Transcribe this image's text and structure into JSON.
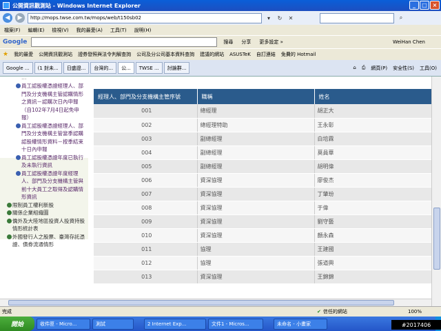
{
  "window": {
    "title": "公開資訊觀測站 - Windows Internet Explorer",
    "buttons": {
      "minimize": "_",
      "maximize": "□",
      "close": "×"
    }
  },
  "address_bar": {
    "url": "http://mops.twse.com.tw/mops/web/t150sb02",
    "back": "◀",
    "forward": "▶"
  },
  "menu": [
    "檔案(F)",
    "編輯(E)",
    "檢視(V)",
    "我的最愛(A)",
    "工具(T)",
    "說明(H)"
  ],
  "google_bar": {
    "logo": "Google",
    "search_btn": "搜尋",
    "share_btn": "分享",
    "more_btn": "更多設定 »",
    "user": "WeiHan Chen"
  },
  "favorites": {
    "label": "我的最愛",
    "items": [
      "公開資訊觀測站",
      "證券發照與法令判解查詢",
      "公司及分公司基本資料查詢",
      "建議的網站",
      "ASUSTeK",
      "自訂連結",
      "免費的 Hotmail"
    ]
  },
  "tabs": {
    "items": [
      "Google ...",
      "(1 封未...",
      "日盛證...",
      "台灣的...",
      "公...",
      "TWSE ...",
      "討論群..."
    ],
    "tools": [
      "網頁(P)",
      "安全性(S)",
      "工具(O)"
    ]
  },
  "sidebar": {
    "sub_items": [
      "員工認股權憑證經理人、部門及分支機構主管認購情形之資訊－認購次日內申報（自102年7月4日起免申報）",
      "員工認股權憑證經理人、部門及分支機構主管當季認購認股權情形資料－按季結束十日內申報",
      "員工認股權憑證年度已執行及未執行資訊",
      "員工認股權憑證年度經理人、部門及分支機構主管與前十大員工之取得及認購情形資訊"
    ],
    "top_items": [
      "限制員工權利新股",
      "關係企業組織圖",
      "僑外及大陸地區投資人投資持股情形統計表",
      "外國發行人之股票、臺灣存託憑證、債券流通情形"
    ]
  },
  "table": {
    "headers": [
      "經理人、部門及分支機構主管序號",
      "職稱",
      "姓名"
    ],
    "rows": [
      {
        "no": "001",
        "title": "總經理",
        "name": "胡正大"
      },
      {
        "no": "002",
        "title": "總經理特助",
        "name": "王永彰"
      },
      {
        "no": "003",
        "title": "副總經理",
        "name": "白培霖"
      },
      {
        "no": "004",
        "title": "副總經理",
        "name": "莫員華"
      },
      {
        "no": "005",
        "title": "副總經理",
        "name": "胡明偉"
      },
      {
        "no": "006",
        "title": "資深協理",
        "name": "廖俊杰"
      },
      {
        "no": "007",
        "title": "資深協理",
        "name": "丁肇玢"
      },
      {
        "no": "008",
        "title": "資深協理",
        "name": "于偉"
      },
      {
        "no": "009",
        "title": "資深協理",
        "name": "劉守藝"
      },
      {
        "no": "010",
        "title": "資深協理",
        "name": "顏永森"
      },
      {
        "no": "011",
        "title": "協理",
        "name": "王建國"
      },
      {
        "no": "012",
        "title": "協理",
        "name": "張道興"
      },
      {
        "no": "013",
        "title": "資深協理",
        "name": "王錦錦"
      }
    ]
  },
  "status": {
    "left": "完成",
    "zone": "信任的網站",
    "zoom": "100%"
  },
  "taskbar": {
    "start": "開始",
    "tasks": [
      "收件匣 - Micro...",
      "測試",
      "2 Internet Exp...",
      "文件1 - Micros...",
      "未命名 - 小畫家"
    ]
  },
  "watermark": "#2017406",
  "colors": {
    "header_bg": "#2a5b8c",
    "title_bar": "#0a5fd8",
    "taskbar": "#2456c8"
  }
}
